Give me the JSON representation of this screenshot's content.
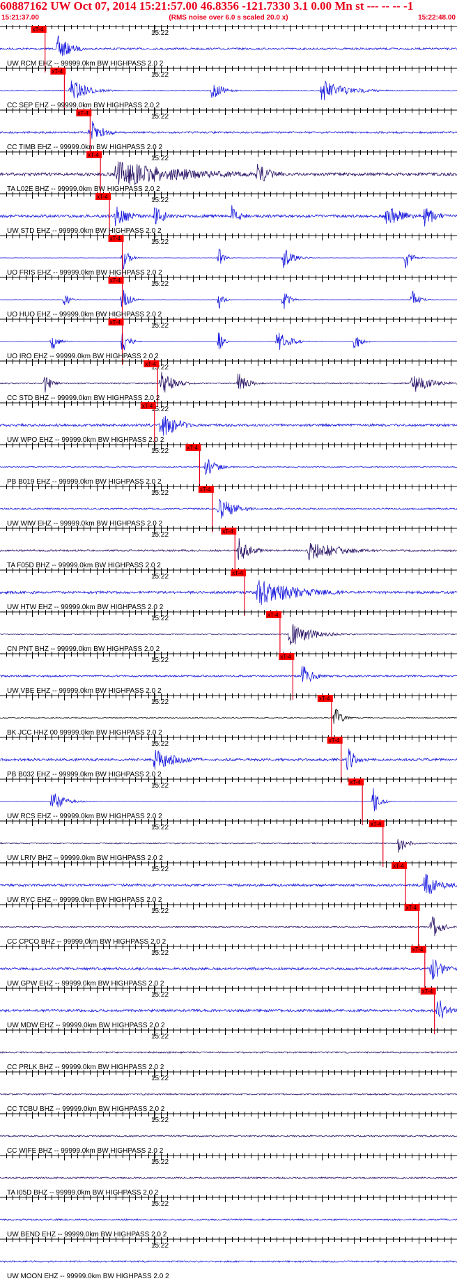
{
  "header": {
    "title": "60887162 UW Oct 07, 2014 15:21:57.00   46.8356 -121.7330  3.1 0.00 Mn st --- -- --  -1",
    "start_time": "15:21:37.00",
    "noise_note": "(RMS noise over 6.0 s scaled 20.0 x)",
    "end_time": "15:22:48.00"
  },
  "colors": {
    "title": "#e8001c",
    "axis": "#000000",
    "pick_box": "#ff0000",
    "pick_line": "#e8001c"
  },
  "chart_data": {
    "type": "line",
    "x_range": [
      "15:21:37.00",
      "15:22:48.00"
    ],
    "minute_marker": "15:22",
    "pick_label": "xT-4",
    "channels": [
      {
        "label": "UW RCM EHZ -- 99999.0km BW  HIGHPASS  2.0  2",
        "color": "#1a1adc",
        "pick_s": 7.0,
        "burst_s": [
          9,
          4
        ],
        "noise": 0.6
      },
      {
        "label": "CC SEP EHZ -- 99999.0km BW  HIGHPASS  2.0  2",
        "color": "#1a1adc",
        "pick_s": 10.0,
        "burst_s": [
          11,
          5
        ],
        "noise": 0.25,
        "extra_burst_s": [
          [
            50,
            8
          ],
          [
            33,
            3
          ]
        ]
      },
      {
        "label": "CC TIMB EHZ -- 99999.0km BW  HIGHPASS  2.0  2",
        "color": "#1a1adc",
        "pick_s": 14.0,
        "burst_s": [
          14,
          4
        ],
        "noise": 0.6
      },
      {
        "label": "TA L02E BHZ -- 99999.0km BW  HIGHPASS  2.0  2",
        "color": "#2a1466",
        "pick_s": 15.6,
        "burst_s": [
          18,
          24
        ],
        "noise": 1.0,
        "extra_burst_s": [
          [
            40,
            5
          ]
        ]
      },
      {
        "label": "UW STD EHZ -- 99999.0km BW  HIGHPASS  2.0  2",
        "color": "#1a1adc",
        "pick_s": 17.0,
        "burst_s": [
          18,
          4
        ],
        "noise": 0.9,
        "extra_burst_s": [
          [
            24,
            4
          ],
          [
            36,
            3
          ],
          [
            60,
            6
          ],
          [
            66,
            4
          ]
        ]
      },
      {
        "label": "UO FRIS EHZ -- 99999.0km BW  HIGHPASS  2.0  2",
        "color": "#1a1adc",
        "pick_s": 19.0,
        "burst_s": [
          19,
          2
        ],
        "noise": 0.1,
        "extra_burst_s": [
          [
            44,
            3
          ],
          [
            63,
            2
          ],
          [
            34,
            1
          ]
        ]
      },
      {
        "label": "UO HUO EHZ -- 99999.0km BW  HIGHPASS  2.0  2",
        "color": "#1a1adc",
        "pick_s": 19.0,
        "burst_s": [
          19,
          2
        ],
        "noise": 0.1,
        "extra_burst_s": [
          [
            44,
            2
          ],
          [
            64,
            2
          ],
          [
            34,
            1
          ],
          [
            10,
            1
          ]
        ]
      },
      {
        "label": "UO IRO EHZ -- 99999.0km BW  HIGHPASS  2.0  2",
        "color": "#1a1adc",
        "pick_s": 19.0,
        "burst_s": [
          19,
          2
        ],
        "noise": 0.1,
        "extra_burst_s": [
          [
            43,
            4
          ],
          [
            55,
            2
          ],
          [
            34,
            1
          ],
          [
            8,
            2
          ]
        ]
      },
      {
        "label": "CC STD BHZ -- 99999.0km BW  HIGHPASS  2.0  2",
        "color": "#2a1466",
        "pick_s": 24.5,
        "burst_s": [
          25,
          4
        ],
        "noise": 0.4,
        "extra_burst_s": [
          [
            37,
            3
          ],
          [
            64,
            6
          ],
          [
            7,
            2
          ]
        ]
      },
      {
        "label": "UW WPO EHZ -- 99999.0km BW  HIGHPASS  2.0  2",
        "color": "#1a1adc",
        "pick_s": 24.0,
        "burst_s": [
          25,
          6
        ],
        "noise": 0.8
      },
      {
        "label": "PB B019 EHZ -- 99999.0km BW  HIGHPASS  2.0  2",
        "color": "#1a1adc",
        "pick_s": 31.0,
        "burst_s": [
          32,
          3
        ],
        "noise": 0.3
      },
      {
        "label": "UW WIW EHZ -- 99999.0km BW  HIGHPASS  2.0  2",
        "color": "#1a1adc",
        "pick_s": 33.0,
        "burst_s": [
          34,
          5
        ],
        "noise": 0.5
      },
      {
        "label": "TA F05D BHZ -- 99999.0km BW  HIGHPASS  2.0  2",
        "color": "#2a1466",
        "pick_s": 36.5,
        "burst_s": [
          37,
          4
        ],
        "noise": 0.6,
        "extra_burst_s": [
          [
            48,
            10
          ]
        ]
      },
      {
        "label": "UW HTW EHZ -- 99999.0km BW  HIGHPASS  2.0  2",
        "color": "#1a1adc",
        "pick_s": 38.0,
        "burst_s": [
          40,
          14
        ],
        "noise": 0.8
      },
      {
        "label": "CN PNT BHZ -- 99999.0km BW  HIGHPASS  2.0  2",
        "color": "#2a1466",
        "pick_s": 43.5,
        "burst_s": [
          45,
          7
        ],
        "noise": 0.3
      },
      {
        "label": "UW VBE EHZ -- 99999.0km BW  HIGHPASS  2.0  2",
        "color": "#1a1adc",
        "pick_s": 45.5,
        "burst_s": [
          47,
          3
        ],
        "noise": 0.6
      },
      {
        "label": "BK JCC HHZ 00 99999.0km BW  HIGHPASS  2.0  2",
        "color": "#111111",
        "pick_s": 51.5,
        "burst_s": [
          52,
          2
        ],
        "noise": 0.3
      },
      {
        "label": "PB B032 EHZ -- 99999.0km BW  HIGHPASS  2.0  2",
        "color": "#1a1adc",
        "pick_s": 53.0,
        "burst_s": [
          54,
          3
        ],
        "noise": 0.8,
        "extra_burst_s": [
          [
            24,
            8
          ]
        ]
      },
      {
        "label": "UW RCS EHZ -- 99999.0km BW  HIGHPASS  2.0  2",
        "color": "#1a1adc",
        "pick_s": 56.3,
        "burst_s": [
          58,
          2
        ],
        "noise": 0.1,
        "extra_burst_s": [
          [
            8,
            4
          ]
        ]
      },
      {
        "label": "UW LRIV BHZ -- 99999.0km BW  HIGHPASS  2.0  2",
        "color": "#2a1466",
        "pick_s": 59.5,
        "burst_s": [
          62,
          2
        ],
        "noise": 0.4
      },
      {
        "label": "UW RYC EHZ -- 99999.0km BW  HIGHPASS  2.0  2",
        "color": "#1a1adc",
        "pick_s": 63.0,
        "burst_s": [
          66,
          5
        ],
        "noise": 0.8
      },
      {
        "label": "CC CPCO BHZ -- 99999.0km BW  HIGHPASS  2.0  2",
        "color": "#2a1466",
        "pick_s": 65.0,
        "burst_s": [
          67,
          3
        ],
        "noise": 0.4
      },
      {
        "label": "UW GPW EHZ -- 99999.0km BW  HIGHPASS  2.0  2",
        "color": "#1a1adc",
        "pick_s": 66.0,
        "burst_s": [
          67,
          4
        ],
        "noise": 0.8
      },
      {
        "label": "UW MDW EHZ -- 99999.0km BW  HIGHPASS  2.0  2",
        "color": "#1a1adc",
        "pick_s": 67.5,
        "burst_s": [
          68,
          3
        ],
        "noise": 0.8
      },
      {
        "label": "CC PRLK BHZ -- 99999.0km BW  HIGHPASS  2.0  2",
        "color": "#2a1466",
        "noise": 0.5
      },
      {
        "label": "CC TCBU BHZ -- 99999.0km BW  HIGHPASS  2.0  2",
        "color": "#2a1466",
        "noise": 0.5
      },
      {
        "label": "CC WIFE BHZ -- 99999.0km BW  HIGHPASS  2.0  2",
        "color": "#2a1466",
        "noise": 0.5
      },
      {
        "label": "TA I05D BHZ -- 99999.0km BW  HIGHPASS  2.0  2",
        "color": "#2a1466",
        "noise": 0.5
      },
      {
        "label": "UW BEND EHZ -- 99999.0km BW  HIGHPASS  2.0  2",
        "color": "#1a1adc",
        "noise": 0.5
      },
      {
        "label": "UW MOON EHZ -- 99999.0km BW  HIGHPASS  2.0  2",
        "color": "#1a1adc",
        "noise": 0.5
      }
    ]
  }
}
